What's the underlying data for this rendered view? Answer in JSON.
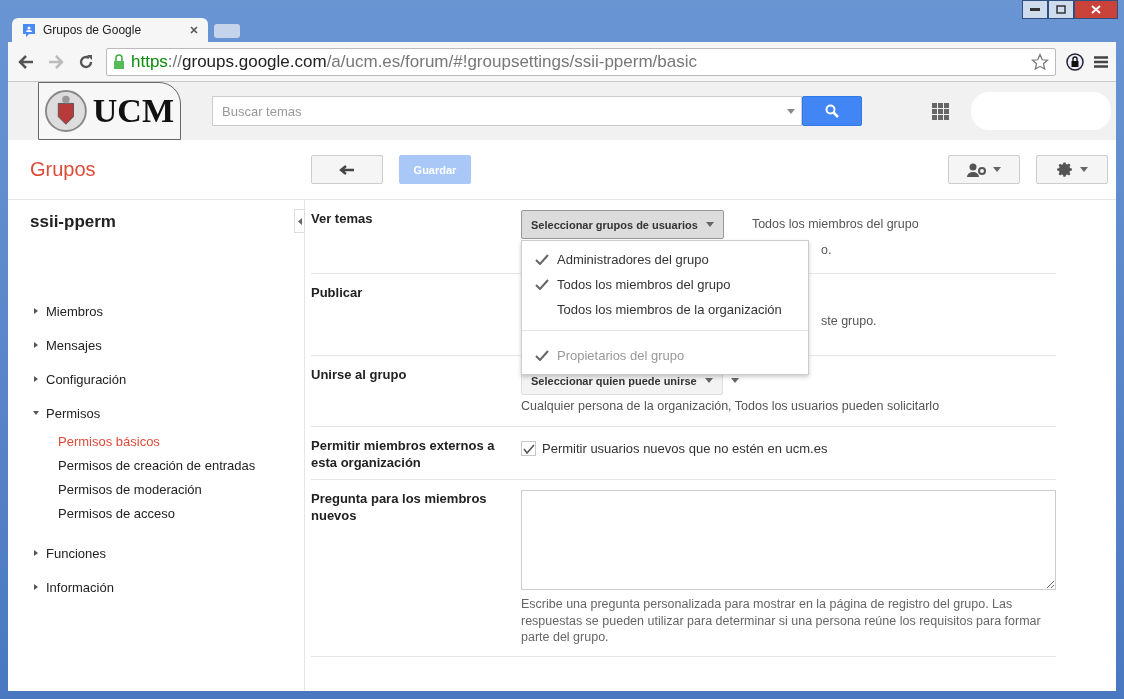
{
  "browser": {
    "tab_title": "Grupos de Google",
    "url_scheme": "https",
    "url_sep": "://",
    "url_host": "groups.google.com",
    "url_path": "/a/ucm.es/forum/#!groupsettings/ssii-pperm/basic"
  },
  "topbar": {
    "logo": "UCM",
    "search": {
      "placeholder": "Buscar temas"
    }
  },
  "header": {
    "app_title": "Grupos",
    "save_button": {
      "label": "Guardar",
      "disabled": true
    }
  },
  "sidebar": {
    "group_name": "ssii-pperm",
    "items": [
      {
        "label": "Miembros",
        "expanded": false
      },
      {
        "label": "Mensajes",
        "expanded": false
      },
      {
        "label": "Configuración",
        "expanded": false
      },
      {
        "label": "Permisos",
        "expanded": true,
        "children": [
          {
            "label": "Permisos básicos",
            "selected": true
          },
          {
            "label": "Permisos de creación de entradas",
            "selected": false
          },
          {
            "label": "Permisos de moderación",
            "selected": false
          },
          {
            "label": "Permisos de acceso",
            "selected": false
          }
        ]
      },
      {
        "label": "Funciones",
        "expanded": false
      },
      {
        "label": "Información",
        "expanded": false
      }
    ]
  },
  "settings": [
    {
      "kind": "select",
      "label": "Ver temas",
      "select_label": "Seleccionar grupos de usuarios",
      "value_text": "Todos los miembros del grupo",
      "note": "o.",
      "open": true
    },
    {
      "kind": "partial",
      "label": "Publicar",
      "note": "ste grupo."
    },
    {
      "kind": "select",
      "label": "Unirse al grupo",
      "select_label": "Seleccionar quien puede unirse",
      "value_text": "Cualquier persona de la organización, Todos los usuarios pueden solicitarlo",
      "open": false
    },
    {
      "kind": "checkbox",
      "label": "Permitir miembros externos a esta organización",
      "text": "Permitir usuarios nuevos que no estén en ucm.es",
      "checked": true
    },
    {
      "kind": "textarea",
      "label": "Pregunta para los miembros nuevos",
      "help": "Escribe una pregunta personalizada para mostrar en la página de registro del grupo. Las respuestas se pueden utilizar para determinar si una persona reúne los requisitos para formar parte del grupo."
    }
  ],
  "dropdown": {
    "items": [
      {
        "label": "Administradores del grupo",
        "checked": true,
        "disabled": false
      },
      {
        "label": "Todos los miembros del grupo",
        "checked": true,
        "disabled": false
      },
      {
        "label": "Todos los miembros de la organización",
        "checked": false,
        "disabled": false
      },
      {
        "label": "Propietarios del grupo",
        "checked": true,
        "disabled": true
      }
    ]
  }
}
